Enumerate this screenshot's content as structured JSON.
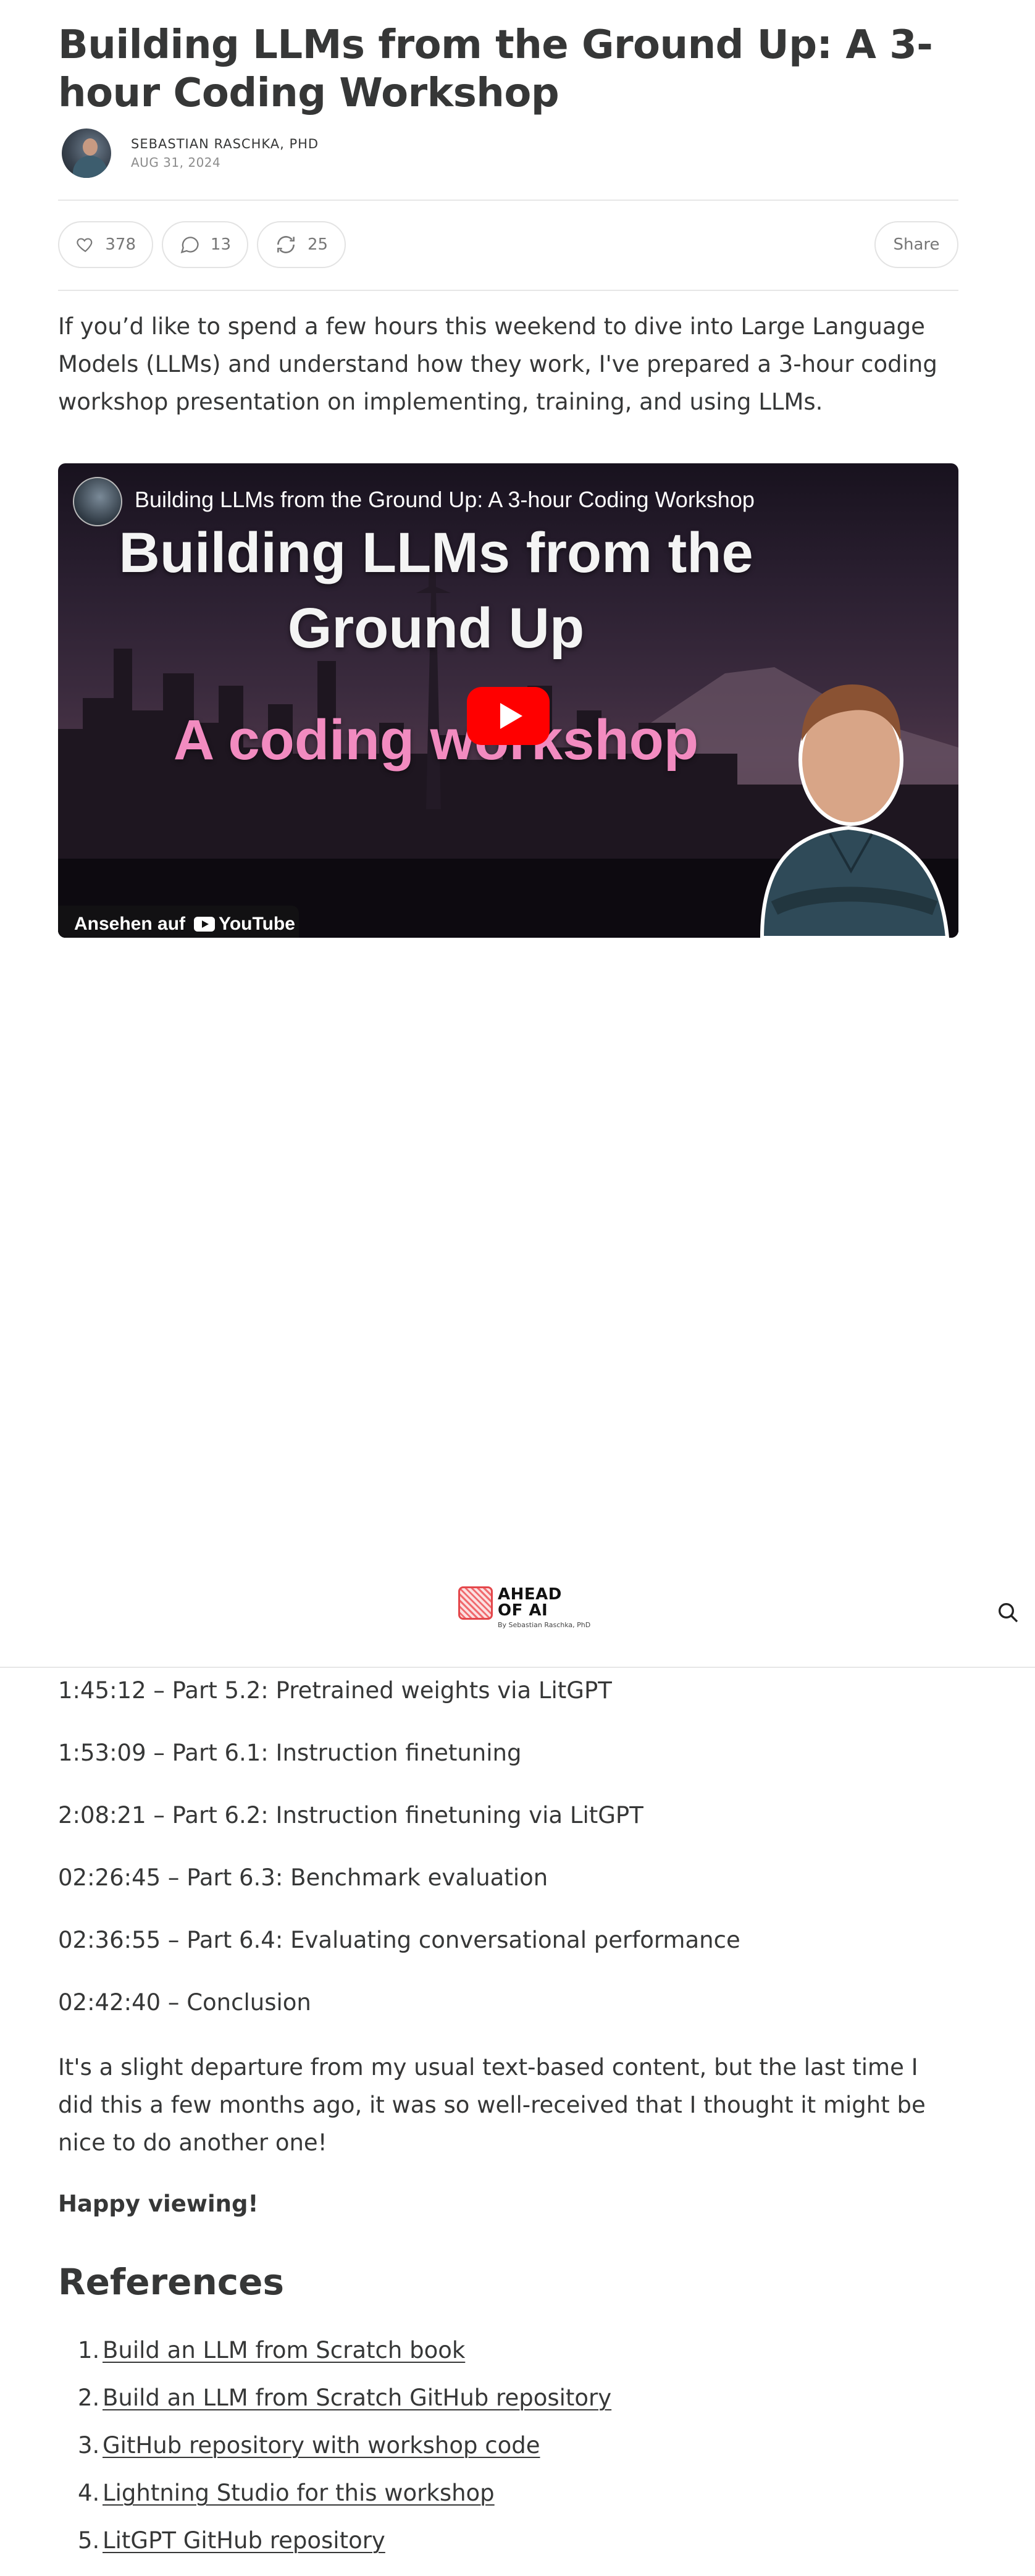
{
  "post": {
    "title": "Building LLMs from the Ground Up: A 3-hour Coding Workshop",
    "author": "SEBASTIAN RASCHKA, PHD",
    "date": "AUG 31, 2024",
    "intro": "If you’d like to spend a few hours this weekend to dive into Large Language Models (LLMs) and understand how they work, I've prepared a 3-hour coding workshop presentation on implementing, training, and using LLMs."
  },
  "actions": {
    "likes": "378",
    "comments": "13",
    "restacks": "25",
    "share_label": "Share"
  },
  "video": {
    "title": "Building LLMs from the Ground Up: A 3-hour Coding Workshop",
    "headline_line1": "Building LLMs from the",
    "headline_line2": "Ground Up",
    "subheadline": "A coding workshop",
    "watch_on": "Ansehen auf",
    "platform": "YouTube"
  },
  "site_header": {
    "logo_line1": "AHEAD",
    "logo_line2": "OF AI",
    "logo_sub": "By Sebastian Raschka, PhD"
  },
  "timeline": [
    "1:45:12 – Part 5.2: Pretrained weights via LitGPT",
    "1:53:09 – Part 6.1: Instruction finetuning",
    "2:08:21 – Part 6.2: Instruction finetuning via LitGPT",
    "02:26:45 – Part 6.3: Benchmark evaluation",
    "02:36:55 – Part 6.4: Evaluating conversational performance",
    "02:42:40 – Conclusion"
  ],
  "closing": {
    "paragraph": "It's a slight departure from my usual text-based content, but the last time I did this a few months ago, it was so well-received that I thought it might be nice to do another one!",
    "signoff": "Happy viewing!"
  },
  "references": {
    "heading": "References",
    "items": [
      {
        "num": "1.",
        "label": "Build an LLM from Scratch book"
      },
      {
        "num": "2.",
        "label": "Build an LLM from Scratch GitHub repository"
      },
      {
        "num": "3.",
        "label": "GitHub repository with workshop code"
      },
      {
        "num": "4.",
        "label": "Lightning Studio for this workshop"
      },
      {
        "num": "5.",
        "label": "LitGPT GitHub repository"
      }
    ]
  },
  "colors": {
    "text": "#363737",
    "muted": "#8c8c8c",
    "youtube_red": "#ff0000",
    "headline_pink": "#f28bc0",
    "brand_red": "#e4474b"
  }
}
